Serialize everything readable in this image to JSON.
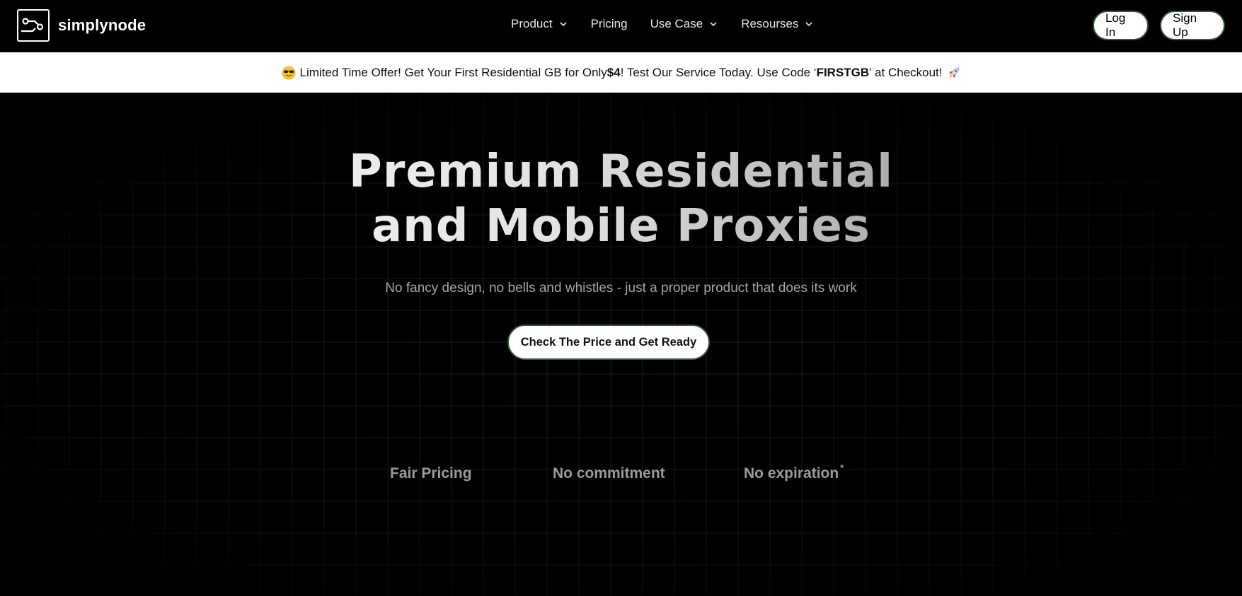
{
  "brand": {
    "name": "simplynode"
  },
  "nav": {
    "items": [
      {
        "label": "Product",
        "has_dropdown": true
      },
      {
        "label": "Pricing",
        "has_dropdown": false
      },
      {
        "label": "Use Case",
        "has_dropdown": true
      },
      {
        "label": "Resourses",
        "has_dropdown": true
      }
    ],
    "login_label": "Log In",
    "signup_label": "Sign Up"
  },
  "promo": {
    "emoji_start": "sunglasses-emoji",
    "text_1": "Limited Time Offer! Get Your First Residential GB for Only ",
    "price": "$4",
    "text_2": "! Test Our Service Today. Use Code ‘",
    "code": "FIRSTGB",
    "text_3": "’ at Checkout!",
    "emoji_end": "rocket-emoji"
  },
  "hero": {
    "title_line_1": "Premium Residential",
    "title_line_2": "and Mobile Proxies",
    "subtitle": "No fancy design, no bells and whistles - just a proper product that does its work",
    "cta_label": "Check The Price and Get Ready",
    "features": [
      {
        "label": "Fair Pricing",
        "note": ""
      },
      {
        "label": "No commitment",
        "note": ""
      },
      {
        "label": "No expiration",
        "note": "*"
      }
    ]
  },
  "colors": {
    "background": "#000000",
    "promo_bg": "#ffffff",
    "button_border": "#2d5a2d",
    "feature_text": "#9b9b9b"
  }
}
